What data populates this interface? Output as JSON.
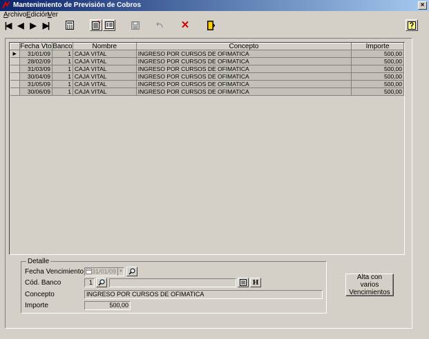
{
  "window": {
    "title": "Mantenimiento de Previsión de Cobros",
    "close_glyph": "×"
  },
  "menu": [
    {
      "label": "Archivo"
    },
    {
      "label": "Edición"
    },
    {
      "label": "Ver"
    }
  ],
  "toolbar": {
    "first_glyph": "|◀",
    "prev_glyph": "◀",
    "next_glyph": "▶",
    "last_glyph": "▶|",
    "delete_glyph": "✕"
  },
  "grid": {
    "columns": [
      "Fecha Vto",
      "Banco",
      "Nombre",
      "Concepto",
      "Importe"
    ],
    "current_row_marker": "▶",
    "rows": [
      {
        "fecha": "31/01/09",
        "banco": "1",
        "nombre": "CAJA VITAL",
        "concepto": "INGRESO POR CURSOS DE OFIMATICA",
        "importe": "500,00"
      },
      {
        "fecha": "28/02/09",
        "banco": "1",
        "nombre": "CAJA VITAL",
        "concepto": "INGRESO POR CURSOS DE OFIMATICA",
        "importe": "500,00"
      },
      {
        "fecha": "31/03/09",
        "banco": "1",
        "nombre": "CAJA VITAL",
        "concepto": "INGRESO POR CURSOS DE OFIMATICA",
        "importe": "500,00"
      },
      {
        "fecha": "30/04/09",
        "banco": "1",
        "nombre": "CAJA VITAL",
        "concepto": "INGRESO POR CURSOS DE OFIMATICA",
        "importe": "500,00"
      },
      {
        "fecha": "31/05/09",
        "banco": "1",
        "nombre": "CAJA VITAL",
        "concepto": "INGRESO POR CURSOS DE OFIMATICA",
        "importe": "500,00"
      },
      {
        "fecha": "30/06/09",
        "banco": "1",
        "nombre": "CAJA VITAL",
        "concepto": "INGRESO POR CURSOS DE OFIMATICA",
        "importe": "500,00"
      }
    ]
  },
  "detail": {
    "legend": "Detalle",
    "fecha_label": "Fecha Vencimiento",
    "fecha_value": "31/01/09",
    "banco_label": "Cód. Banco",
    "banco_value": "1",
    "banco_nombre": "",
    "h_button": "H",
    "concepto_label": "Concepto",
    "concepto_value": "INGRESO POR CURSOS DE OFIMATICA",
    "importe_label": "Importe",
    "importe_value": "500,00"
  },
  "alta_button": "Alta con varios Vencimientos",
  "icons": {
    "app": "app-icon",
    "calculator": "calculator-icon",
    "new_record": "new-record-icon",
    "form_view": "form-view-icon",
    "save": "save-icon",
    "undo": "undo-icon",
    "exit": "exit-door-icon",
    "help": "help-icon",
    "search": "search-icon",
    "calendar": "calendar-icon"
  },
  "colors": {
    "title_start": "#0a246a",
    "title_end": "#a6caf0",
    "delete_red": "#d40000"
  }
}
